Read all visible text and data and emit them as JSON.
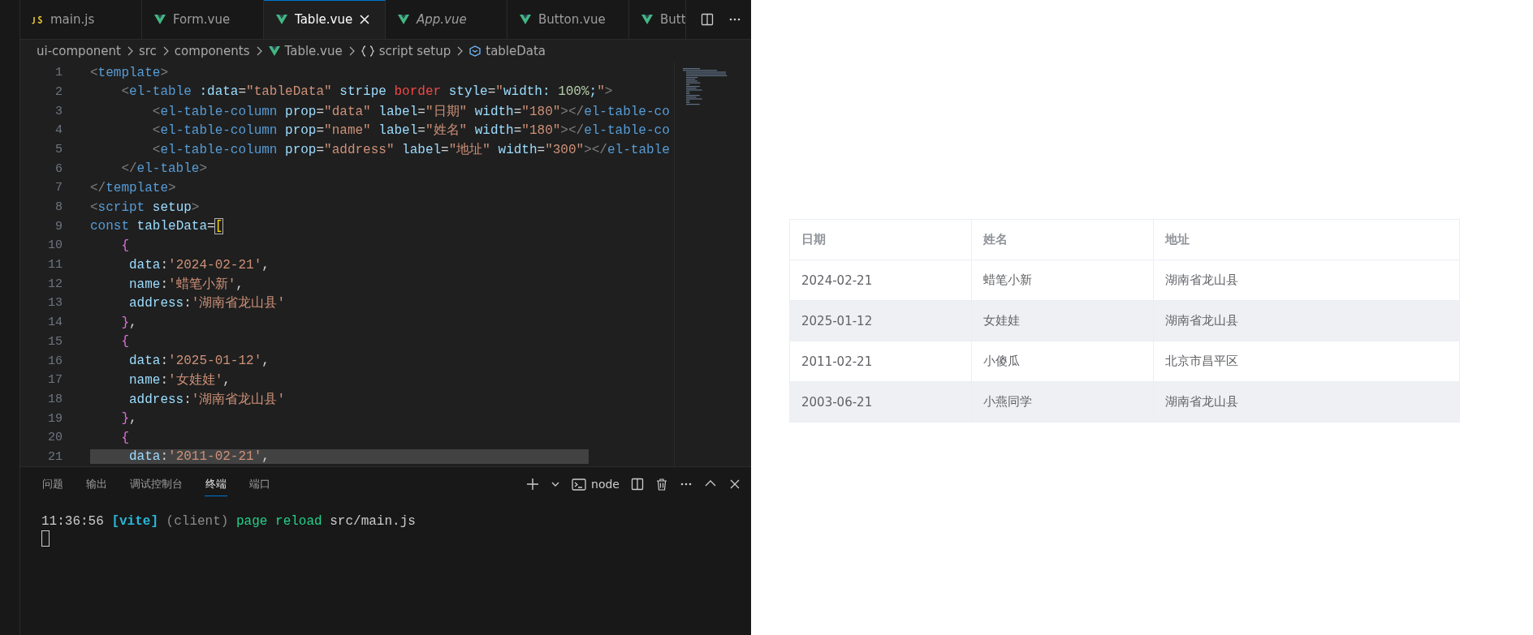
{
  "editor": {
    "tabs": [
      {
        "label": "main.js",
        "kind": "js",
        "selected": false,
        "preview": false
      },
      {
        "label": "Form.vue",
        "kind": "vue",
        "selected": false,
        "preview": false
      },
      {
        "label": "Table.vue",
        "kind": "vue",
        "selected": true,
        "preview": false
      },
      {
        "label": "App.vue",
        "kind": "vue",
        "selected": false,
        "preview": true
      },
      {
        "label": "Button.vue",
        "kind": "vue",
        "selected": false,
        "preview": false
      },
      {
        "label": "Butt",
        "kind": "vue",
        "selected": false,
        "preview": false
      }
    ],
    "breadcrumb": [
      {
        "label": "ui-component",
        "kind": "folder"
      },
      {
        "label": "src",
        "kind": "folder"
      },
      {
        "label": "components",
        "kind": "folder"
      },
      {
        "label": "Table.vue",
        "kind": "vue"
      },
      {
        "label": "script setup",
        "kind": "block"
      },
      {
        "label": "tableData",
        "kind": "variable"
      }
    ],
    "lines": [
      {
        "number": "1",
        "highlighted": false,
        "tokens": [
          {
            "kind": "punct",
            "text": "<"
          },
          {
            "kind": "tag",
            "text": "template"
          },
          {
            "kind": "punct",
            "text": ">"
          }
        ]
      },
      {
        "number": "2",
        "highlighted": false,
        "tokens": [
          {
            "kind": "punct",
            "text": "    <"
          },
          {
            "kind": "tag",
            "text": "el-table"
          },
          {
            "kind": "attr",
            "text": " :data"
          },
          {
            "kind": "plain",
            "text": "="
          },
          {
            "kind": "string",
            "text": "\"tableData\""
          },
          {
            "kind": "attr",
            "text": " stripe"
          },
          {
            "kind": "error",
            "text": " border"
          },
          {
            "kind": "attr",
            "text": " style"
          },
          {
            "kind": "plain",
            "text": "="
          },
          {
            "kind": "string",
            "text": "\""
          },
          {
            "kind": "attr",
            "text": "width: "
          },
          {
            "kind": "number",
            "text": "100%"
          },
          {
            "kind": "attr",
            "text": ";"
          },
          {
            "kind": "string",
            "text": "\""
          },
          {
            "kind": "punct",
            "text": ">"
          }
        ]
      },
      {
        "number": "3",
        "highlighted": false,
        "tokens": [
          {
            "kind": "punct",
            "text": "        <"
          },
          {
            "kind": "tag",
            "text": "el-table-column"
          },
          {
            "kind": "attr",
            "text": " prop"
          },
          {
            "kind": "plain",
            "text": "="
          },
          {
            "kind": "string",
            "text": "\"data\""
          },
          {
            "kind": "attr",
            "text": " label"
          },
          {
            "kind": "plain",
            "text": "="
          },
          {
            "kind": "string",
            "text": "\"日期\""
          },
          {
            "kind": "attr",
            "text": " width"
          },
          {
            "kind": "plain",
            "text": "="
          },
          {
            "kind": "string",
            "text": "\"180\""
          },
          {
            "kind": "punct",
            "text": "></"
          },
          {
            "kind": "tag",
            "text": "el-table-co"
          }
        ]
      },
      {
        "number": "4",
        "highlighted": false,
        "tokens": [
          {
            "kind": "punct",
            "text": "        <"
          },
          {
            "kind": "tag",
            "text": "el-table-column"
          },
          {
            "kind": "attr",
            "text": " prop"
          },
          {
            "kind": "plain",
            "text": "="
          },
          {
            "kind": "string",
            "text": "\"name\""
          },
          {
            "kind": "attr",
            "text": " label"
          },
          {
            "kind": "plain",
            "text": "="
          },
          {
            "kind": "string",
            "text": "\"姓名\""
          },
          {
            "kind": "attr",
            "text": " width"
          },
          {
            "kind": "plain",
            "text": "="
          },
          {
            "kind": "string",
            "text": "\"180\""
          },
          {
            "kind": "punct",
            "text": "></"
          },
          {
            "kind": "tag",
            "text": "el-table-co"
          }
        ]
      },
      {
        "number": "5",
        "highlighted": false,
        "tokens": [
          {
            "kind": "punct",
            "text": "        <"
          },
          {
            "kind": "tag",
            "text": "el-table-column"
          },
          {
            "kind": "attr",
            "text": " prop"
          },
          {
            "kind": "plain",
            "text": "="
          },
          {
            "kind": "string",
            "text": "\"address\""
          },
          {
            "kind": "attr",
            "text": " label"
          },
          {
            "kind": "plain",
            "text": "="
          },
          {
            "kind": "string",
            "text": "\"地址\""
          },
          {
            "kind": "attr",
            "text": " width"
          },
          {
            "kind": "plain",
            "text": "="
          },
          {
            "kind": "string",
            "text": "\"300\""
          },
          {
            "kind": "punct",
            "text": "></"
          },
          {
            "kind": "tag",
            "text": "el-table"
          }
        ]
      },
      {
        "number": "6",
        "highlighted": false,
        "tokens": [
          {
            "kind": "punct",
            "text": "    </"
          },
          {
            "kind": "tag",
            "text": "el-table"
          },
          {
            "kind": "punct",
            "text": ">"
          }
        ]
      },
      {
        "number": "7",
        "highlighted": false,
        "tokens": [
          {
            "kind": "punct",
            "text": "</"
          },
          {
            "kind": "tag",
            "text": "template"
          },
          {
            "kind": "punct",
            "text": ">"
          }
        ]
      },
      {
        "number": "8",
        "highlighted": false,
        "tokens": [
          {
            "kind": "punct",
            "text": "<"
          },
          {
            "kind": "tag",
            "text": "script"
          },
          {
            "kind": "attr",
            "text": " setup"
          },
          {
            "kind": "punct",
            "text": ">"
          }
        ]
      },
      {
        "number": "9",
        "highlighted": false,
        "tokens": [
          {
            "kind": "keyword",
            "text": "const"
          },
          {
            "kind": "attr",
            "text": " tableData"
          },
          {
            "kind": "plain",
            "text": "="
          },
          {
            "kind": "bracket",
            "text": "["
          }
        ]
      },
      {
        "number": "10",
        "highlighted": false,
        "tokens": [
          {
            "kind": "brace",
            "text": "    {"
          }
        ]
      },
      {
        "number": "11",
        "highlighted": false,
        "tokens": [
          {
            "kind": "attr",
            "text": "     data"
          },
          {
            "kind": "plain",
            "text": ":"
          },
          {
            "kind": "string",
            "text": "'2024-02-21'"
          },
          {
            "kind": "plain",
            "text": ","
          }
        ]
      },
      {
        "number": "12",
        "highlighted": false,
        "tokens": [
          {
            "kind": "attr",
            "text": "     name"
          },
          {
            "kind": "plain",
            "text": ":"
          },
          {
            "kind": "string",
            "text": "'蜡笔小新'"
          },
          {
            "kind": "plain",
            "text": ","
          }
        ]
      },
      {
        "number": "13",
        "highlighted": false,
        "tokens": [
          {
            "kind": "attr",
            "text": "     address"
          },
          {
            "kind": "plain",
            "text": ":"
          },
          {
            "kind": "string",
            "text": "'湖南省龙山县'"
          }
        ]
      },
      {
        "number": "14",
        "highlighted": false,
        "tokens": [
          {
            "kind": "brace",
            "text": "    }"
          },
          {
            "kind": "plain",
            "text": ","
          }
        ]
      },
      {
        "number": "15",
        "highlighted": false,
        "tokens": [
          {
            "kind": "brace",
            "text": "    {"
          }
        ]
      },
      {
        "number": "16",
        "highlighted": false,
        "tokens": [
          {
            "kind": "attr",
            "text": "     data"
          },
          {
            "kind": "plain",
            "text": ":"
          },
          {
            "kind": "string",
            "text": "'2025-01-12'"
          },
          {
            "kind": "plain",
            "text": ","
          }
        ]
      },
      {
        "number": "17",
        "highlighted": false,
        "tokens": [
          {
            "kind": "attr",
            "text": "     name"
          },
          {
            "kind": "plain",
            "text": ":"
          },
          {
            "kind": "string",
            "text": "'女娃娃'"
          },
          {
            "kind": "plain",
            "text": ","
          }
        ]
      },
      {
        "number": "18",
        "highlighted": false,
        "tokens": [
          {
            "kind": "attr",
            "text": "     address"
          },
          {
            "kind": "plain",
            "text": ":"
          },
          {
            "kind": "string",
            "text": "'湖南省龙山县'"
          }
        ]
      },
      {
        "number": "19",
        "highlighted": false,
        "tokens": [
          {
            "kind": "brace",
            "text": "    }"
          },
          {
            "kind": "plain",
            "text": ","
          }
        ]
      },
      {
        "number": "20",
        "highlighted": false,
        "tokens": [
          {
            "kind": "brace",
            "text": "    {"
          }
        ]
      },
      {
        "number": "21",
        "highlighted": true,
        "tokens": [
          {
            "kind": "attr",
            "text": "     data"
          },
          {
            "kind": "plain",
            "text": ":"
          },
          {
            "kind": "string",
            "text": "'2011-02-21'"
          },
          {
            "kind": "plain",
            "text": ","
          }
        ]
      }
    ]
  },
  "panel": {
    "tabs": [
      {
        "label": "问题",
        "selected": false
      },
      {
        "label": "输出",
        "selected": false
      },
      {
        "label": "调试控制台",
        "selected": false
      },
      {
        "label": "终端",
        "selected": true
      },
      {
        "label": "端口",
        "selected": false
      }
    ],
    "shell": "node",
    "output": [
      {
        "kind": "time",
        "text": "11:36:56"
      },
      {
        "kind": "tag",
        "text": "[vite]"
      },
      {
        "kind": "muted",
        "text": "(client)"
      },
      {
        "kind": "ok",
        "text": "page reload"
      },
      {
        "kind": "plain",
        "text": "src/main.js"
      }
    ]
  },
  "preview": {
    "table": {
      "striped": true,
      "columns": [
        "日期",
        "姓名",
        "地址"
      ],
      "rows": [
        [
          "2024-02-21",
          "蜡笔小新",
          "湖南省龙山县"
        ],
        [
          "2025-01-12",
          "女娃娃",
          "湖南省龙山县"
        ],
        [
          "2011-02-21",
          "小傻瓜",
          "北京市昌平区"
        ],
        [
          "2003-06-21",
          "小燕同学",
          "湖南省龙山县"
        ]
      ]
    }
  }
}
